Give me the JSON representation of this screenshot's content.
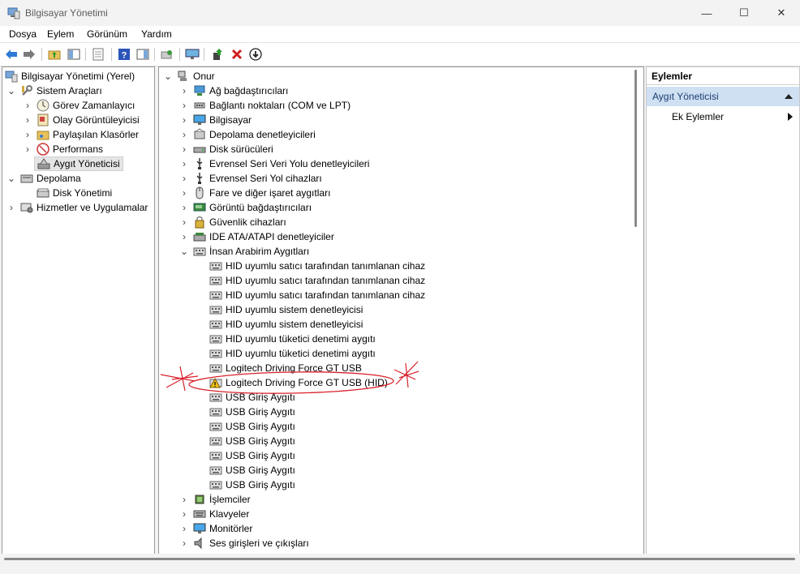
{
  "window": {
    "title": "Bilgisayar Yönetimi",
    "minimize": "—",
    "maximize": "☐",
    "close": "✕"
  },
  "menu": [
    "Dosya",
    "Eylem",
    "Görünüm",
    "Yardım"
  ],
  "left_tree": [
    {
      "label": "Bilgisayar Yönetimi (Yerel)",
      "icon": "computer-management-icon"
    },
    {
      "label": "Sistem Araçları",
      "icon": "tools-icon"
    },
    {
      "label": "Görev Zamanlayıcı",
      "icon": "clock-icon"
    },
    {
      "label": "Olay Görüntüleyicisi",
      "icon": "event-viewer-icon"
    },
    {
      "label": "Paylaşılan Klasörler",
      "icon": "shared-folder-icon"
    },
    {
      "label": "Performans",
      "icon": "performance-icon"
    },
    {
      "label": "Aygıt Yöneticisi",
      "icon": "device-manager-icon"
    },
    {
      "label": "Depolama",
      "icon": "storage-icon"
    },
    {
      "label": "Disk Yönetimi",
      "icon": "disk-icon"
    },
    {
      "label": "Hizmetler ve Uygulamalar",
      "icon": "services-icon"
    }
  ],
  "device_tree": {
    "root": "Onur",
    "categories": [
      {
        "label": "Ağ bağdaştırıcıları",
        "icon": "network-adapter-icon"
      },
      {
        "label": "Bağlantı noktaları (COM ve LPT)",
        "icon": "port-icon"
      },
      {
        "label": "Bilgisayar",
        "icon": "monitor-icon"
      },
      {
        "label": "Depolama denetleyicileri",
        "icon": "storage-controller-icon"
      },
      {
        "label": "Disk sürücüleri",
        "icon": "disk-drive-icon"
      },
      {
        "label": "Evrensel Seri Veri Yolu denetleyicileri",
        "icon": "usb-icon"
      },
      {
        "label": "Evrensel Seri Yol cihazları",
        "icon": "usb-icon"
      },
      {
        "label": "Fare ve diğer işaret aygıtları",
        "icon": "mouse-icon"
      },
      {
        "label": "Görüntü bağdaştırıcıları",
        "icon": "display-adapter-icon"
      },
      {
        "label": "Güvenlik cihazları",
        "icon": "security-device-icon"
      },
      {
        "label": "IDE ATA/ATAPI denetleyiciler",
        "icon": "ide-icon"
      },
      {
        "label": "İnsan Arabirim Aygıtları",
        "icon": "hid-icon"
      }
    ],
    "hid_children": [
      {
        "label": "HID uyumlu satıcı tarafından tanımlanan cihaz",
        "warning": false
      },
      {
        "label": "HID uyumlu satıcı tarafından tanımlanan cihaz",
        "warning": false
      },
      {
        "label": "HID uyumlu satıcı tarafından tanımlanan cihaz",
        "warning": false
      },
      {
        "label": "HID uyumlu sistem denetleyicisi",
        "warning": false
      },
      {
        "label": "HID uyumlu sistem denetleyicisi",
        "warning": false
      },
      {
        "label": "HID uyumlu tüketici denetimi aygıtı",
        "warning": false
      },
      {
        "label": "HID uyumlu tüketici denetimi aygıtı",
        "warning": false
      },
      {
        "label": "Logitech Driving Force GT USB",
        "warning": false
      },
      {
        "label": "Logitech Driving Force GT USB (HID)",
        "warning": true
      },
      {
        "label": "USB Giriş Aygıtı",
        "warning": false
      },
      {
        "label": "USB Giriş Aygıtı",
        "warning": false
      },
      {
        "label": "USB Giriş Aygıtı",
        "warning": false
      },
      {
        "label": "USB Giriş Aygıtı",
        "warning": false
      },
      {
        "label": "USB Giriş Aygıtı",
        "warning": false
      },
      {
        "label": "USB Giriş Aygıtı",
        "warning": false
      },
      {
        "label": "USB Giriş Aygıtı",
        "warning": false
      }
    ],
    "more_categories": [
      {
        "label": "İşlemciler",
        "icon": "processor-icon"
      },
      {
        "label": "Klavyeler",
        "icon": "keyboard-icon"
      },
      {
        "label": "Monitörler",
        "icon": "monitor-icon"
      },
      {
        "label": "Ses girişleri ve çıkışları",
        "icon": "speaker-icon"
      }
    ]
  },
  "actions": {
    "header": "Eylemler",
    "section": "Aygıt Yöneticisi",
    "item": "Ek Eylemler"
  },
  "colors": {
    "annotation_red": "#d8202a",
    "selection": "#cfe0f3"
  }
}
